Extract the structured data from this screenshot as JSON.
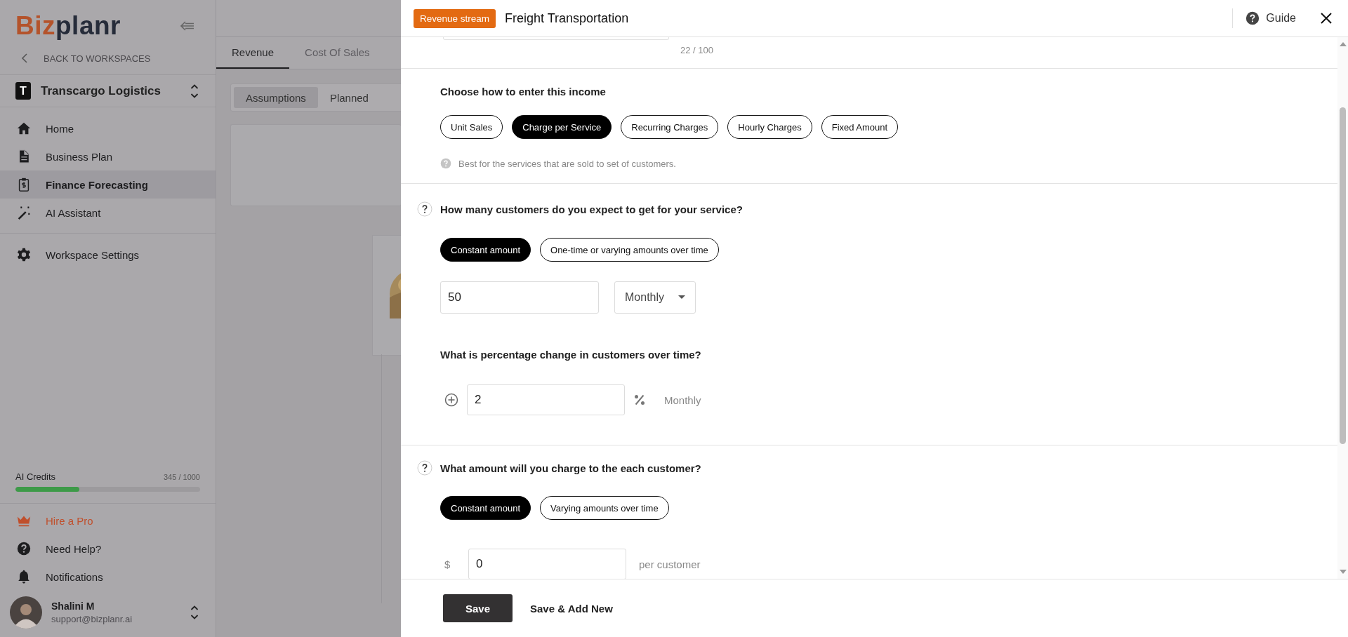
{
  "sidebar": {
    "logo": {
      "accent": "Biz",
      "rest": "planr"
    },
    "back_link": "BACK TO WORKSPACES",
    "workspace": {
      "initial": "T",
      "name": "Transcargo Logistics"
    },
    "nav": [
      {
        "label": "Home",
        "selected": false
      },
      {
        "label": "Business Plan",
        "selected": false
      },
      {
        "label": "Finance Forecasting",
        "selected": true
      },
      {
        "label": "AI Assistant",
        "selected": false
      }
    ],
    "settings": {
      "label": "Workspace Settings",
      "selected": false
    },
    "credits": {
      "label": "AI Credits",
      "reading": "345 / 1000",
      "level": 0.345
    },
    "bottom_items": [
      {
        "label": "Hire a Pro",
        "highlighted": true
      },
      {
        "label": "Need Help?",
        "highlighted": false
      },
      {
        "label": "Notifications",
        "highlighted": false
      }
    ],
    "user": {
      "name": "Shalini M",
      "email": "support@bizplanr.ai"
    }
  },
  "main": {
    "tabs": [
      {
        "label": "Revenue",
        "selected": true
      },
      {
        "label": "Cost Of Sales",
        "selected": false
      }
    ],
    "views": [
      {
        "label": "Assumptions",
        "selected": true
      },
      {
        "label": "Planned",
        "selected": false
      }
    ]
  },
  "dialog": {
    "badge": "Revenue stream",
    "title": "Freight Transportation",
    "guide": "Guide",
    "char_count": "22 / 100",
    "method": {
      "label": "Choose how to enter this income",
      "options": [
        {
          "label": "Unit Sales",
          "selected": false
        },
        {
          "label": "Charge per Service",
          "selected": true
        },
        {
          "label": "Recurring Charges",
          "selected": false
        },
        {
          "label": "Hourly Charges",
          "selected": false
        },
        {
          "label": "Fixed Amount",
          "selected": false
        }
      ],
      "hint": "Best for the services that are sold to set of customers."
    },
    "customers": {
      "label": "How many customers do you expect to get for your service?",
      "modes": [
        {
          "label": "Constant amount",
          "selected": true
        },
        {
          "label": "One-time or varying amounts over time",
          "selected": false
        }
      ],
      "value": "50",
      "period": "Monthly",
      "change_label": "What is percentage change in customers over time?",
      "change_value": "2",
      "change_period": "Monthly"
    },
    "charge": {
      "label": "What amount will you charge to the each customer?",
      "modes": [
        {
          "label": "Constant amount",
          "selected": true
        },
        {
          "label": "Varying amounts over time",
          "selected": false
        }
      ],
      "prefix": "$",
      "value": "0",
      "suffix": "per customer"
    },
    "footer": {
      "save": "Save",
      "save_new": "Save & Add New"
    }
  }
}
